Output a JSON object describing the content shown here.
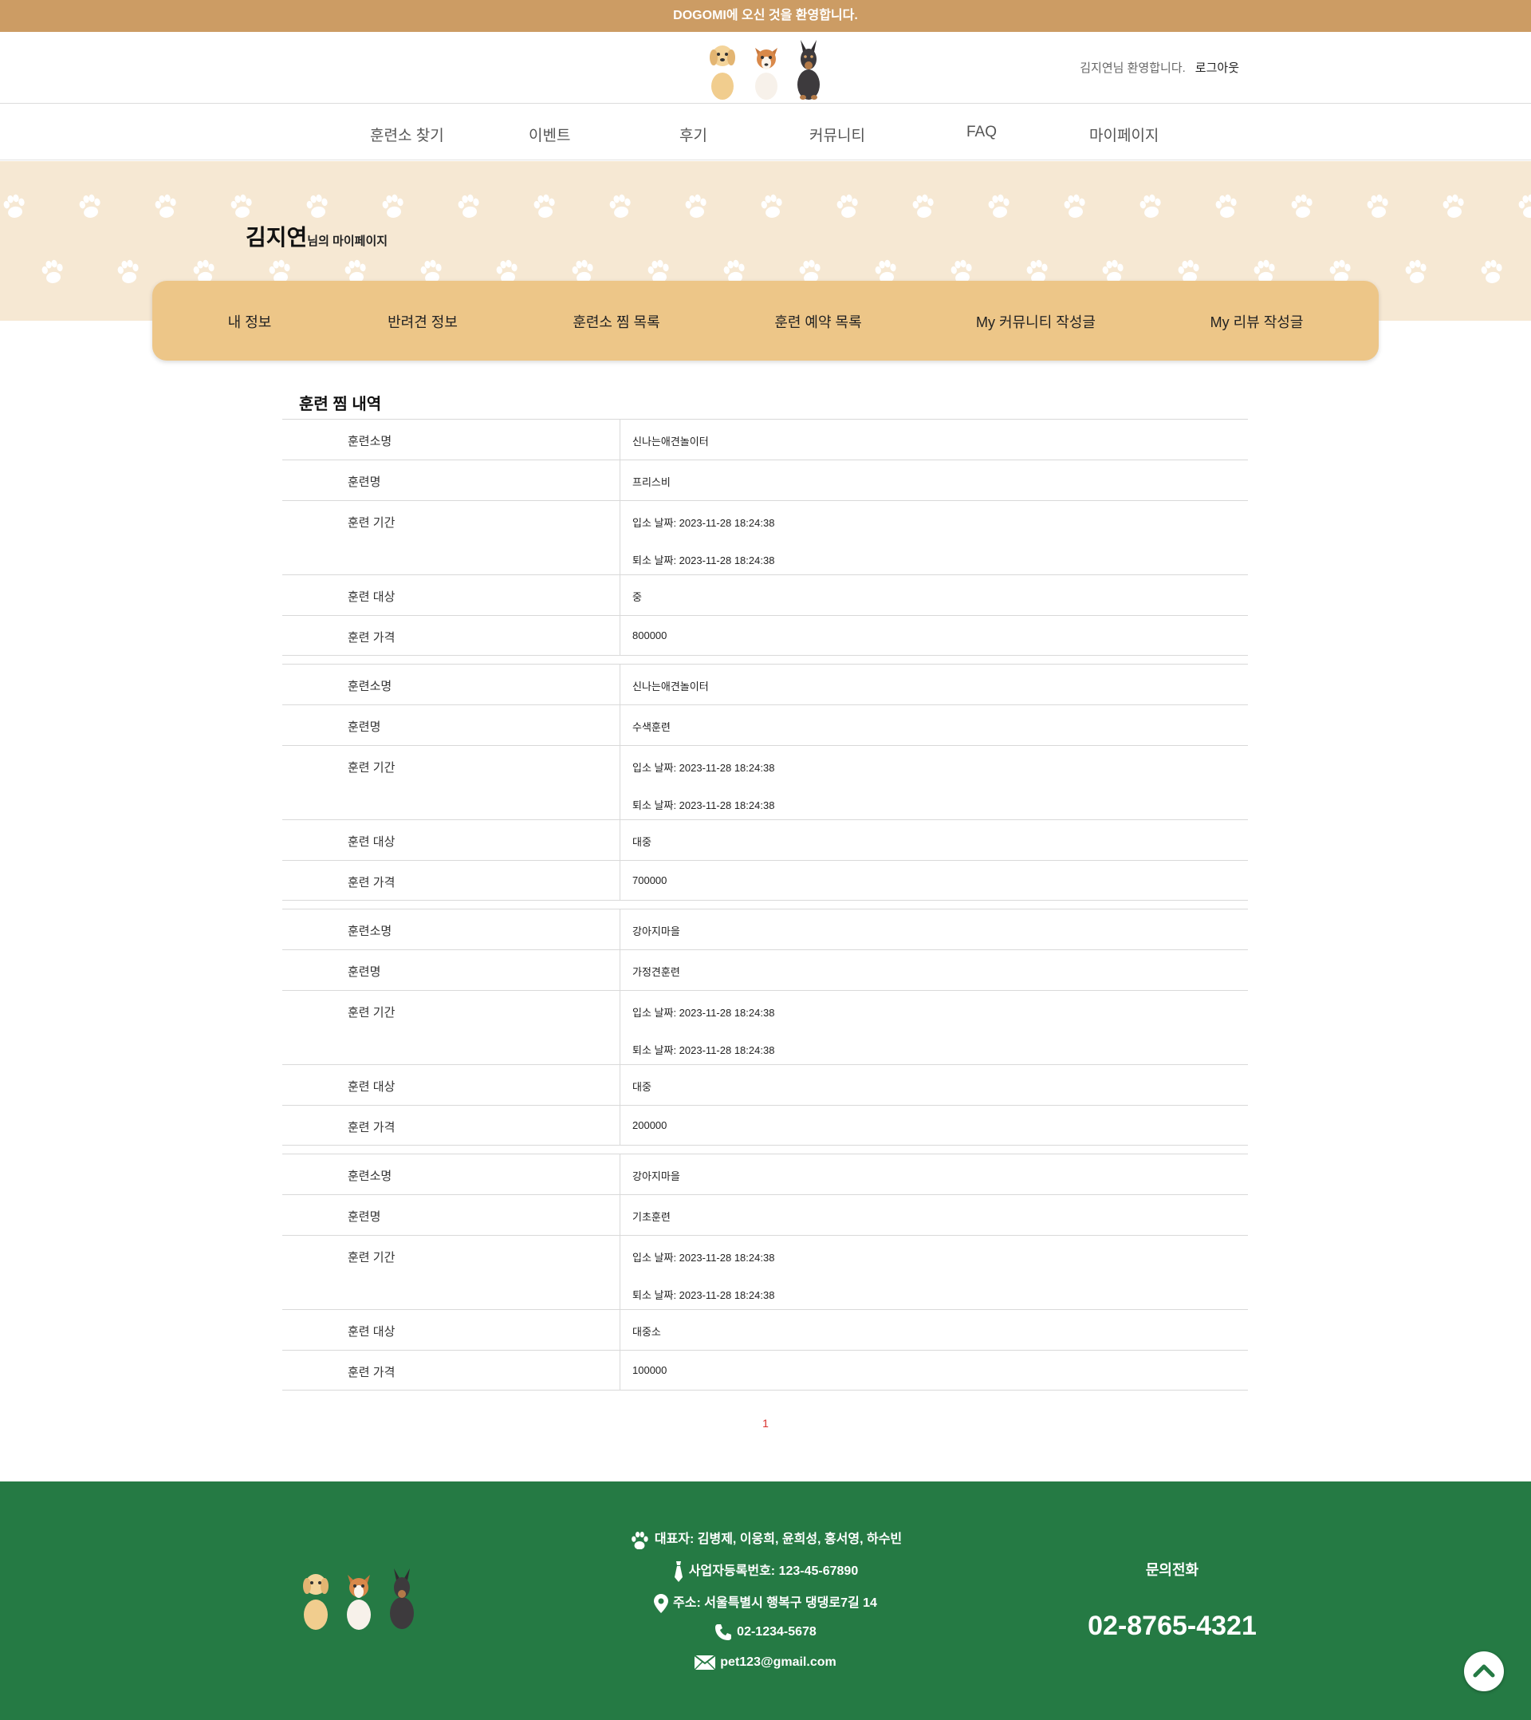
{
  "topbar": {
    "text": "DOGOMI에 오신 것을 환영합니다."
  },
  "header": {
    "welcome": "김지연님 환영합니다.",
    "logout": "로그아웃"
  },
  "nav": [
    "훈련소 찾기",
    "이벤트",
    "후기",
    "커뮤니티",
    "FAQ",
    "마이페이지"
  ],
  "hero": {
    "name": "김지연",
    "suffix": "님의 마이페이지"
  },
  "tabs": [
    "내 정보",
    "반려견 정보",
    "훈련소 찜 목록",
    "훈련 예약 목록",
    "My 커뮤니티 작성글",
    "My 리뷰 작성글"
  ],
  "section_title": "훈련 찜 내역",
  "labels": {
    "center": "훈련소명",
    "program": "훈련명",
    "period": "훈련 기간",
    "target": "훈련 대상",
    "price": "훈련 가격"
  },
  "items": [
    {
      "center": "신나는애견놀이터",
      "program": "프리스비",
      "start": "입소 날짜: 2023-11-28 18:24:38",
      "end": "퇴소 날짜: 2023-11-28 18:24:38",
      "target": "중",
      "price": "800000"
    },
    {
      "center": "신나는애견놀이터",
      "program": "수색훈련",
      "start": "입소 날짜: 2023-11-28 18:24:38",
      "end": "퇴소 날짜: 2023-11-28 18:24:38",
      "target": "대중",
      "price": "700000"
    },
    {
      "center": "강아지마을",
      "program": "가정견훈련",
      "start": "입소 날짜: 2023-11-28 18:24:38",
      "end": "퇴소 날짜: 2023-11-28 18:24:38",
      "target": "대중",
      "price": "200000"
    },
    {
      "center": "강아지마을",
      "program": "기초훈련",
      "start": "입소 날짜: 2023-11-28 18:24:38",
      "end": "퇴소 날짜: 2023-11-28 18:24:38",
      "target": "대중소",
      "price": "100000"
    }
  ],
  "pagination": {
    "current": "1"
  },
  "footer": {
    "representatives": "대표자: 김병제, 이웅희, 윤희성, 홍서영, 하수빈",
    "business_no": "사업자등록번호: 123-45-67890",
    "address": "주소: 서울특별시 행복구 댕댕로7길 14",
    "phone": "02-1234-5678",
    "email": "pet123@gmail.com",
    "contact_title": "문의전화",
    "contact_phone": "02-8765-4321"
  },
  "colors": {
    "topbar": "#cc9c64",
    "hero_bg": "#f6e8d3",
    "tab_bg": "#edc688",
    "footer_bg": "#257a44",
    "page_active": "#d9302c"
  }
}
